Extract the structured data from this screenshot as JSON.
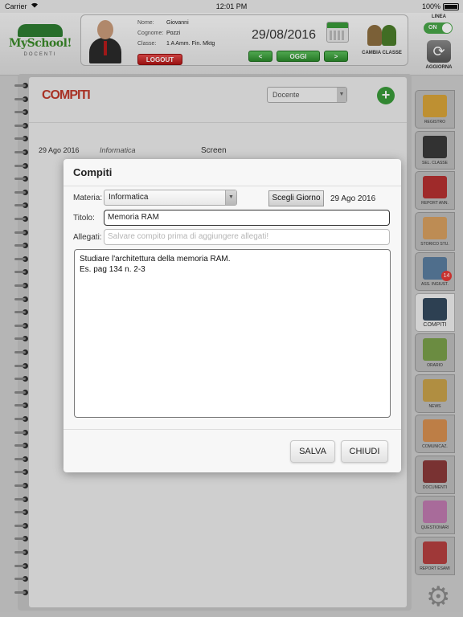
{
  "status_bar": {
    "carrier": "Carrier",
    "time": "12:01 PM",
    "battery": "100%"
  },
  "logo": {
    "name": "MySchool!",
    "sub": "DOCENTI"
  },
  "user": {
    "nome_label": "Nome:",
    "nome": "Giovanni",
    "cognome_label": "Cognome:",
    "cognome": "Pozzi",
    "classe_label": "Classe:",
    "classe": "1 A Amm. Fin. Mktg"
  },
  "logout_label": "LOGOUT",
  "current_date": "29/08/2016",
  "nav": {
    "prev": "<",
    "today": "OGGI",
    "next": ">"
  },
  "cambia_classe": "CAMBIA CLASSE",
  "linea": {
    "label": "LINEA",
    "toggle": "ON"
  },
  "aggiorna": "AGGIORNA",
  "page": {
    "title": "COMPITI",
    "docente_select": "Docente",
    "row": {
      "date": "29 Ago 2016",
      "subject": "Informatica",
      "title": "Screen"
    }
  },
  "tabs": [
    {
      "label": "REGISTRO",
      "icon": "registro-icon",
      "color": "#d9a43a"
    },
    {
      "label": "SEL. CLASSE",
      "icon": "blackboard-icon",
      "color": "#3a3a3a"
    },
    {
      "label": "REPORT ANN.",
      "icon": "books-icon",
      "color": "#b53030"
    },
    {
      "label": "STORICO STU.",
      "icon": "student-icon",
      "color": "#d8a060"
    },
    {
      "label": "ASS. INGIUST.",
      "icon": "calendar-icon",
      "color": "#5a7ea0",
      "badge": "14"
    },
    {
      "label": "COMPITI",
      "icon": "calculator-icon",
      "color": "#34495e"
    },
    {
      "label": "ORARIO",
      "icon": "schedule-icon",
      "color": "#7aa04a"
    },
    {
      "label": "NEWS",
      "icon": "clipboard-icon",
      "color": "#c9a24a"
    },
    {
      "label": "COMUNICAZ.",
      "icon": "people-icon",
      "color": "#d89050"
    },
    {
      "label": "DOCUMENTI",
      "icon": "documents-icon",
      "color": "#8a3a3a"
    },
    {
      "label": "QUESTIONARI",
      "icon": "questionnaire-icon",
      "color": "#c07ab0"
    },
    {
      "label": "REPORT ESAMI",
      "icon": "report-icon",
      "color": "#b54040"
    }
  ],
  "modal": {
    "title": "Compiti",
    "materia_label": "Materia:",
    "materia_value": "Informatica",
    "scegli_giorno": "Scegli Giorno",
    "selected_date": "29 Ago 2016",
    "titolo_label": "Titolo:",
    "titolo_value": "Memoria RAM",
    "allegati_label": "Allegati:",
    "allegati_placeholder": "Salvare compito prima di aggiungere allegati!",
    "body_text": "Studiare l'architettura della memoria RAM.\nEs. pag 134 n. 2-3",
    "save_label": "SALVA",
    "close_label": "CHIUDI"
  }
}
